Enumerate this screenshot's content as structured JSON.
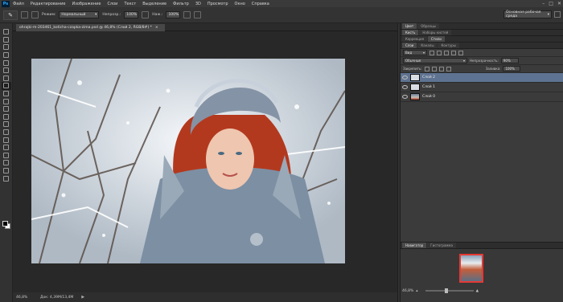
{
  "app": {
    "logo": "Ps"
  },
  "menu": [
    "Файл",
    "Редактирование",
    "Изображение",
    "Слои",
    "Текст",
    "Выделение",
    "Фильтр",
    "3D",
    "Просмотр",
    "Окно",
    "Справка"
  ],
  "window_controls": {
    "minimize": "–",
    "maximize": "□",
    "close": "✕"
  },
  "options": {
    "mode_label": "Режим:",
    "mode_value": "Нормальный",
    "opacity_label": "Непрозр.:",
    "opacity_value": "100%",
    "flow_label": "Наж.:",
    "flow_value": "100%",
    "workspace": "Основная рабочая среда"
  },
  "document": {
    "tab_title": "ohrajki-m-203461_koticha-czapka-zima.psd @ 46,8% (Слой 2, RGB/8#) *",
    "close": "×"
  },
  "status": {
    "zoom": "46,8%",
    "doc": "Док: 4,39M/13,4M",
    "arrow": "▶"
  },
  "panels": {
    "top_tabs": [
      "Цвет",
      "Образцы"
    ],
    "top_tabs2": [
      "Кисть",
      "Наборы кистей"
    ],
    "adjust_tabs": [
      "Коррекция",
      "Стили"
    ],
    "layer_tabs": [
      "Слои",
      "Каналы",
      "Контуры"
    ],
    "kind_label": "Вид",
    "blend_mode": "Обычные",
    "opacity_label": "Непрозрачность:",
    "opacity_value": "90%",
    "lock_label": "Закрепить:",
    "fill_label": "Заливка:",
    "fill_value": "100%",
    "layers": [
      {
        "name": "Слой 2",
        "selected": true,
        "thumb": "plain"
      },
      {
        "name": "Слой 1",
        "selected": false,
        "thumb": "plain"
      },
      {
        "name": "Слой 0",
        "selected": false,
        "thumb": "photo"
      }
    ],
    "nav_tabs": [
      "Навигатор",
      "Гистограмма"
    ],
    "nav_zoom": "46,8%"
  },
  "tools": [
    "move-tool",
    "marquee-tool",
    "lasso-tool",
    "quick-select-tool",
    "crop-tool",
    "eyedropper-tool",
    "healing-tool",
    "brush-tool",
    "clone-stamp-tool",
    "history-brush-tool",
    "eraser-tool",
    "gradient-tool",
    "blur-tool",
    "dodge-tool",
    "pen-tool",
    "type-tool",
    "path-select-tool",
    "rectangle-tool",
    "hand-tool",
    "zoom-tool"
  ],
  "selected_tool": "brush-tool"
}
